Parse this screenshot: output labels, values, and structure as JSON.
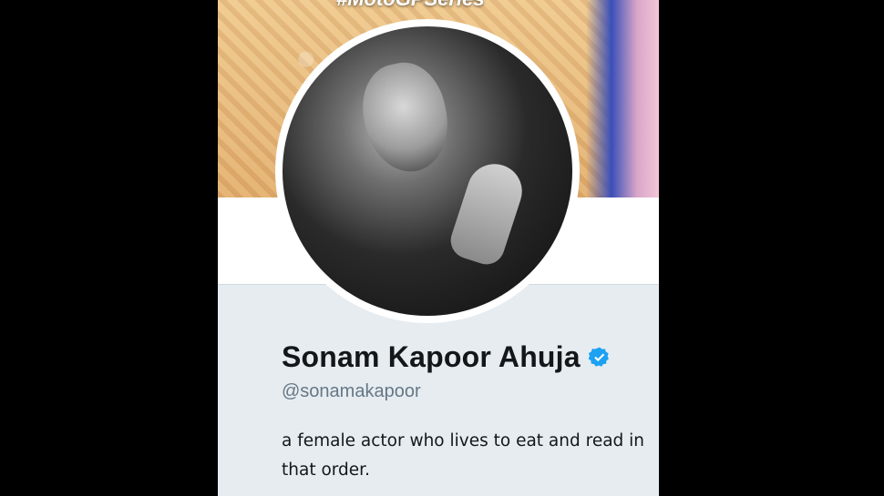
{
  "profile": {
    "banner_hashtag": "#MotoGPSeries",
    "display_name": "Sonam Kapoor Ahuja",
    "verified": true,
    "handle": "@sonamakapoor",
    "bio": "a female actor who lives to eat and read in that order."
  },
  "icons": {
    "verified": "verified-badge-icon"
  },
  "colors": {
    "background": "#000000",
    "profile_panel": "#e6ecf0",
    "verified_blue": "#1da1f2",
    "handle_gray": "#657786",
    "name_text": "#14171a"
  }
}
